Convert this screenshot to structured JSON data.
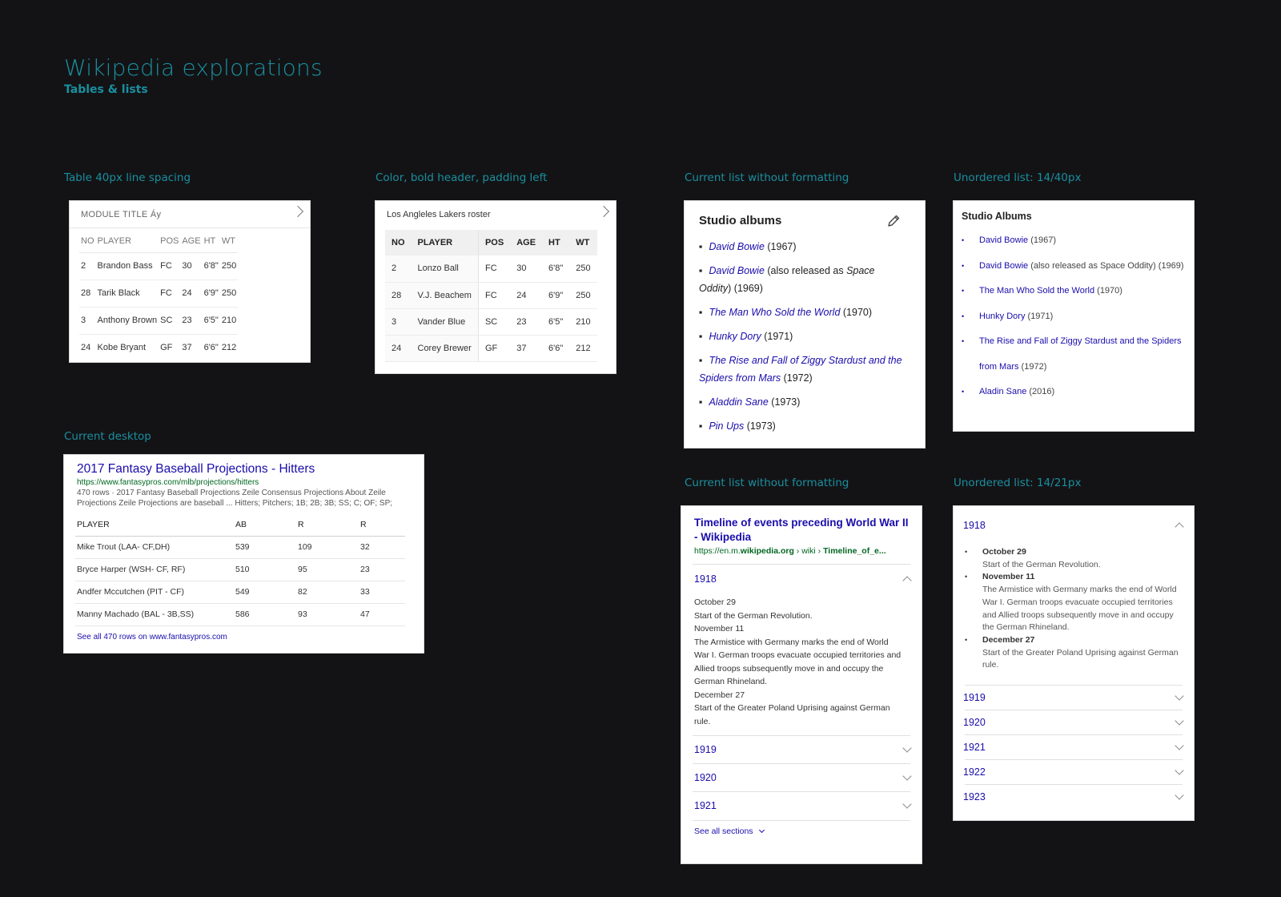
{
  "header": {
    "title": "Wikipedia explorations",
    "subtitle": "Tables & lists"
  },
  "sections": {
    "s1": "Table 40px line spacing",
    "s2": "Color, bold header, padding left",
    "s3": "Current list without formatting",
    "s4": "Unordered list: 14/40px",
    "s5": "Current desktop",
    "s6": "Current list without formatting",
    "s7": "Unordered list: 14/21px"
  },
  "card1": {
    "title": "MODULE TITLE Áy",
    "headers": [
      "NO",
      "PLAYER",
      "POS",
      "AGE",
      "HT",
      "WT"
    ],
    "rows": [
      [
        "2",
        "Brandon Bass",
        "FC",
        "30",
        "6'8\"",
        "250"
      ],
      [
        "28",
        "Tarik Black",
        "FC",
        "24",
        "6'9\"",
        "250"
      ],
      [
        "3",
        "Anthony Brown",
        "SC",
        "23",
        "6'5\"",
        "210"
      ],
      [
        "24",
        "Kobe Bryant",
        "GF",
        "37",
        "6'6\"",
        "212"
      ]
    ]
  },
  "card2": {
    "title": "Los Angleles Lakers roster",
    "headers": [
      "NO",
      "PLAYER",
      "POS",
      "AGE",
      "HT",
      "WT"
    ],
    "rows": [
      [
        "2",
        "Lonzo Ball",
        "FC",
        "30",
        "6'8\"",
        "250"
      ],
      [
        "28",
        "V.J. Beachem",
        "FC",
        "24",
        "6'9\"",
        "250"
      ],
      [
        "3",
        "Vander Blue",
        "SC",
        "23",
        "6'5\"",
        "210"
      ],
      [
        "24",
        "Corey Brewer",
        "GF",
        "37",
        "6'6\"",
        "212"
      ]
    ]
  },
  "card3": {
    "title": "Studio albums",
    "items": [
      {
        "name": "David Bowie",
        "rest": " (1967)"
      },
      {
        "name": "David Bowie",
        "rest": " (also released as ",
        "extra": "Space Oddity",
        "tail": ") (1969)"
      },
      {
        "name": "The Man Who Sold the World",
        "rest": " (1970)"
      },
      {
        "name": "Hunky Dory",
        "rest": " (1971)"
      },
      {
        "name": "The Rise and Fall of Ziggy Stardust and the Spiders from Mars",
        "rest": " (1972)"
      },
      {
        "name": "Aladdin Sane",
        "rest": " (1973)"
      },
      {
        "name": "Pin Ups",
        "rest": " (1973)"
      }
    ]
  },
  "card4": {
    "title": "Studio Albums",
    "items": [
      {
        "name": "David Bowie",
        "rest": " (1967)"
      },
      {
        "name": "David Bowie",
        "rest": " (also released as Space Oddity) (1969)"
      },
      {
        "name": "The Man Who Sold the World",
        "rest": " (1970)"
      },
      {
        "name": "Hunky Dory",
        "rest": " (1971)"
      },
      {
        "name": "The Rise and Fall of Ziggy Stardust and the Spiders from Mars",
        "rest": " (1972)"
      },
      {
        "name": "Aladin Sane",
        "rest": " (2016)"
      }
    ]
  },
  "card5": {
    "title": "2017 Fantasy Baseball Projections - Hitters",
    "url": "https://www.fantasypros.com/mlb/projections/hitters",
    "snippet": "470 rows · 2017 Fantasy Baseball Projections Zeile Consensus Projections About Zeile Projections Zeile Projections are baseball ... Hitters; Pitchers; 1B; 2B; 3B; SS; C; OF; SP;",
    "headers": [
      "PLAYER",
      "AB",
      "R",
      "R"
    ],
    "rows": [
      [
        "Mike Trout (LAA- CF,DH)",
        "539",
        "109",
        "32"
      ],
      [
        "Bryce Harper (WSH- CF, RF)",
        "510",
        "95",
        "23"
      ],
      [
        "Andfer Mccutchen (PIT - CF)",
        "549",
        "82",
        "33"
      ],
      [
        "Manny Machado (BAL - 3B,SS)",
        "586",
        "93",
        "47"
      ]
    ],
    "link": "See all 470 rows on www.fantasypros.com"
  },
  "card7": {
    "title": "Timeline of events preceding World War II - Wikipedia",
    "url_prefix": "https://en.m.",
    "url_bold": "wikipedia.org",
    "url_mid": " › wiki › ",
    "url_tail": "Timeline_of_e...",
    "open_year": "1918",
    "body": [
      "October 29",
      "Start of the German Revolution.",
      "November 11",
      "The Armistice with Germany marks the end of World War I. German troops evacuate occupied territories and Allied troops subsequently move in and occupy the German Rhineland.",
      "December 27",
      "Start of the Greater Poland Uprising against German rule."
    ],
    "years": [
      "1919",
      "1920",
      "1921"
    ],
    "see_all": "See all sections"
  },
  "card8": {
    "open_year": "1918",
    "events": [
      {
        "date": "October 29",
        "text": "Start of the German Revolution."
      },
      {
        "date": "November 11",
        "text": "The Armistice with Germany marks the end of World War I. German troops evacuate occupied territories and Allied troops subsequently move in and occupy the German Rhineland."
      },
      {
        "date": "December 27",
        "text": "Start of the Greater Poland Uprising against German rule."
      }
    ],
    "years": [
      "1919",
      "1920",
      "1921",
      "1922",
      "1923"
    ]
  },
  "colors": {
    "accent": "#1a8fa0",
    "link": "#1a0dab",
    "url_green": "#006621",
    "background": "#131315"
  }
}
